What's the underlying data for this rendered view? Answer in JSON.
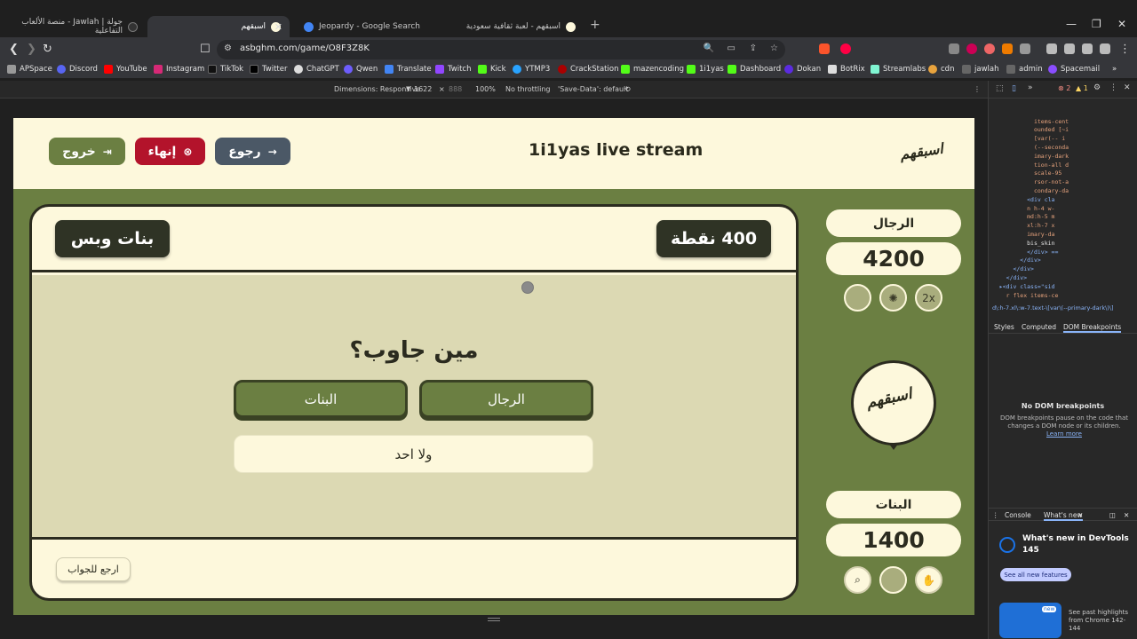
{
  "browser": {
    "tabs": [
      {
        "title": "جولة | Jawlah - منصة الألعاب التفاعلية"
      },
      {
        "title": "اسبقهم"
      },
      {
        "title": "Jeopardy - Google Search"
      },
      {
        "title": "اسبقهم - لعبة ثقافية سعودية"
      }
    ],
    "url": "asbghm.com/game/O8F3Z8K",
    "bookmarks": [
      "APSpace",
      "Discord",
      "YouTube",
      "Instagram",
      "TikTok",
      "Twitter",
      "ChatGPT",
      "Qwen",
      "Translate",
      "Twitch",
      "Kick",
      "YTMP3",
      "CrackStation",
      "mazencoding",
      "1i1yas",
      "Dashboard",
      "Dokan",
      "BotRix",
      "Streamlabs",
      "cdn",
      "jawlah",
      "admin",
      "Spacemail"
    ]
  },
  "devbar": {
    "dimensions": "Dimensions: Responsive",
    "width": "1622",
    "height": "888",
    "zoom": "100%",
    "throttle": "No throttling",
    "savedata": "'Save-Data': default"
  },
  "game": {
    "logo": "اسبقهم",
    "title": "1i1yas live stream",
    "buttons": {
      "back": "رجوع",
      "end": "إنهاء",
      "exit": "خروج"
    },
    "category": "بنات وبس",
    "points": "400 نقطة",
    "question": "مين جاوب؟",
    "answers": {
      "men": "الرجال",
      "women": "البنات",
      "none": "ولا احد"
    },
    "back_to_answer": "ارجع للجواب",
    "teams": [
      {
        "name": "الرجال",
        "score": "4200",
        "powerup_label": "2x"
      },
      {
        "name": "البنات",
        "score": "1400"
      }
    ]
  },
  "devtools": {
    "code_lines": [
      "            items-cent",
      "            ounded [~i",
      "            [var(-- i",
      "            (--seconda",
      "            imary-dark",
      "            tion-all d",
      "            scale-95",
      "",
      "            rsor-not-a",
      "            condary-da",
      "          <div cla",
      "          n h-4 w-",
      "          md:h-5 m",
      "          xl:h-7 x",
      "          imary-da",
      "          bis_skin",
      "          </div> ==",
      "        </div>",
      "      </div>",
      "    </div>",
      "  ▸<div class=\"sid",
      "    r flex items-ce"
    ],
    "breadcrumb": "d\\:h-7.xl\\:w-7.text-\\[var\\(--primary-dark\\)\\]",
    "error_count": "2",
    "warn_count": "1",
    "tabs": [
      "Styles",
      "Computed",
      "DOM Breakpoints"
    ],
    "no_dom_title": "No DOM breakpoints",
    "no_dom_desc": "DOM breakpoints pause on the code that changes a DOM node or its children.",
    "learn_more": "Learn more",
    "drawer_tabs": [
      "Console",
      "What's new"
    ],
    "whats_new_title": "What's new in DevTools",
    "whats_new_version": "145",
    "see_all": "See all new features",
    "badge_new": "new",
    "highlights": "See past highlights from Chrome 142-144"
  }
}
